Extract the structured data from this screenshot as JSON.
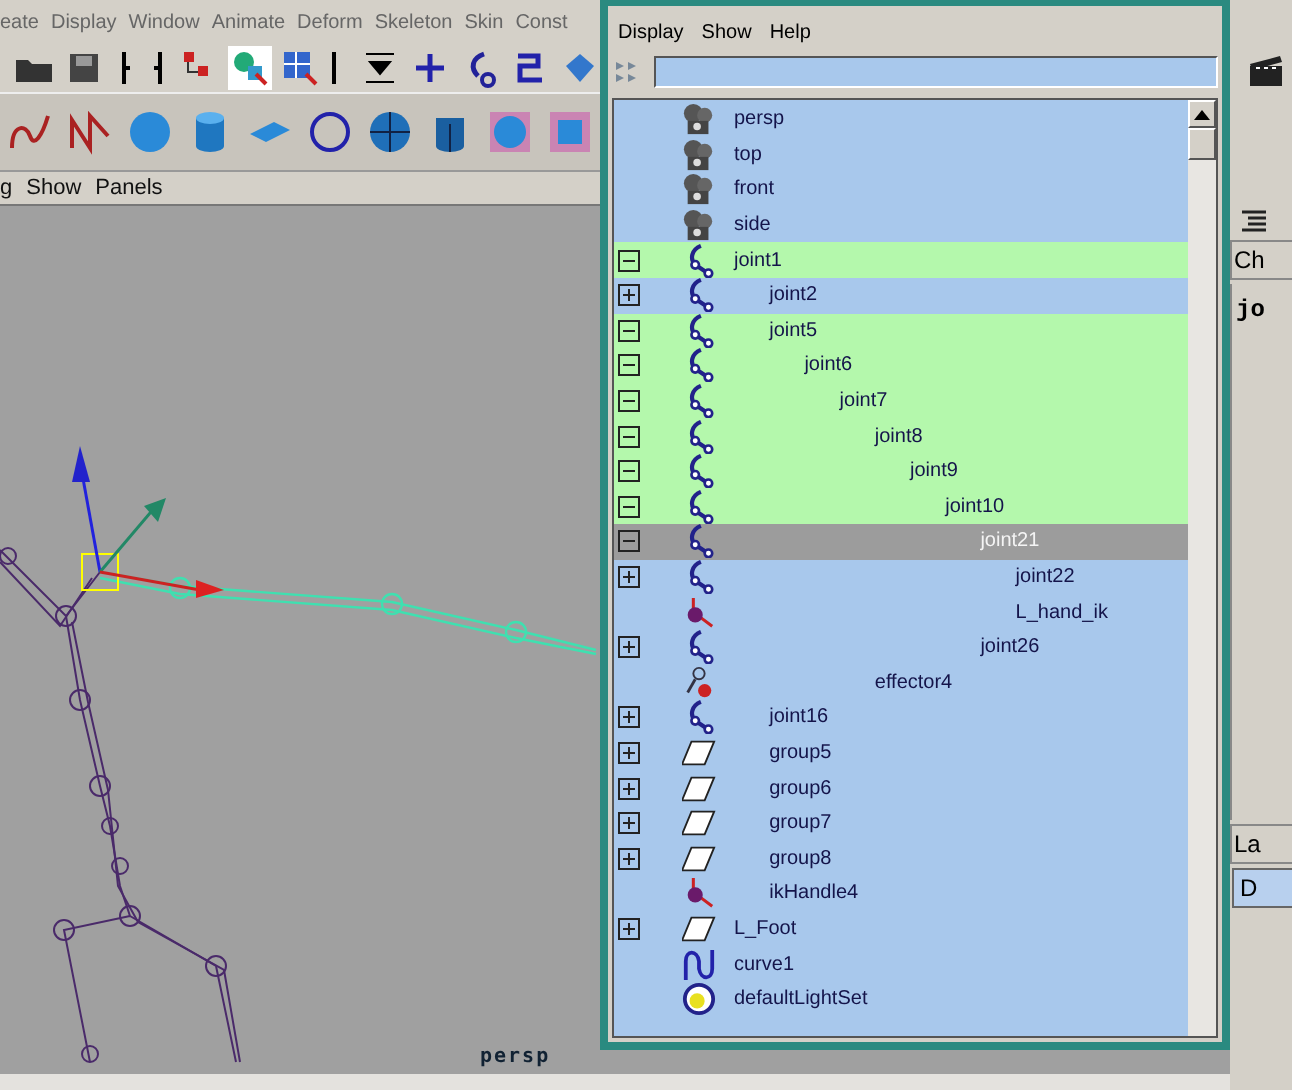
{
  "app_menu": [
    "eate",
    "Display",
    "Window",
    "Animate",
    "Deform",
    "Skeleton",
    "Skin",
    "Const"
  ],
  "panel_menu": [
    "g",
    "Show",
    "Panels"
  ],
  "viewport": {
    "camera_label": "persp"
  },
  "outliner": {
    "menu": [
      "Display",
      "Show",
      "Help"
    ],
    "items": [
      {
        "label": "persp",
        "kind": "camera",
        "expandable": false,
        "selected": false,
        "active": false
      },
      {
        "label": "top",
        "kind": "camera",
        "expandable": false,
        "selected": false,
        "active": false
      },
      {
        "label": "front",
        "kind": "camera",
        "expandable": false,
        "selected": false,
        "active": false
      },
      {
        "label": "side",
        "kind": "camera",
        "expandable": false,
        "selected": false,
        "active": false
      },
      {
        "label": "joint1",
        "kind": "joint",
        "expandable": true,
        "expanded": true,
        "selected": true,
        "active": false,
        "children": [
          {
            "label": "joint2",
            "kind": "joint",
            "expandable": true,
            "expanded": false,
            "selected": false,
            "active": false
          },
          {
            "label": "joint5",
            "kind": "joint",
            "expandable": true,
            "expanded": true,
            "selected": true,
            "active": false,
            "children": [
              {
                "label": "joint6",
                "kind": "joint",
                "expandable": true,
                "expanded": true,
                "selected": true,
                "active": false,
                "children": [
                  {
                    "label": "joint7",
                    "kind": "joint",
                    "expandable": true,
                    "expanded": true,
                    "selected": true,
                    "active": false,
                    "children": [
                      {
                        "label": "joint8",
                        "kind": "joint",
                        "expandable": true,
                        "expanded": true,
                        "selected": true,
                        "active": false,
                        "children": [
                          {
                            "label": "joint9",
                            "kind": "joint",
                            "expandable": true,
                            "expanded": true,
                            "selected": true,
                            "active": false,
                            "children": [
                              {
                                "label": "joint10",
                                "kind": "joint",
                                "expandable": true,
                                "expanded": true,
                                "selected": true,
                                "active": false,
                                "children": [
                                  {
                                    "label": "joint21",
                                    "kind": "joint",
                                    "expandable": true,
                                    "expanded": true,
                                    "selected": false,
                                    "active": true,
                                    "children": [
                                      {
                                        "label": "joint22",
                                        "kind": "joint",
                                        "expandable": true,
                                        "expanded": false,
                                        "selected": false,
                                        "active": false
                                      },
                                      {
                                        "label": "L_hand_ik",
                                        "kind": "ik_handle",
                                        "expandable": false,
                                        "selected": false,
                                        "active": false
                                      }
                                    ]
                                  },
                                  {
                                    "label": "joint26",
                                    "kind": "joint",
                                    "expandable": true,
                                    "expanded": false,
                                    "selected": false,
                                    "active": false
                                  }
                                ]
                              }
                            ]
                          }
                        ]
                      },
                      {
                        "label": "effector4",
                        "kind": "effector",
                        "expandable": false,
                        "selected": false,
                        "active": false
                      }
                    ]
                  }
                ]
              }
            ]
          },
          {
            "label": "joint16",
            "kind": "joint",
            "expandable": true,
            "expanded": false,
            "selected": false,
            "active": false
          },
          {
            "label": "group5",
            "kind": "group",
            "expandable": true,
            "expanded": false,
            "selected": false,
            "active": false
          },
          {
            "label": "group6",
            "kind": "group",
            "expandable": true,
            "expanded": false,
            "selected": false,
            "active": false
          },
          {
            "label": "group7",
            "kind": "group",
            "expandable": true,
            "expanded": false,
            "selected": false,
            "active": false
          },
          {
            "label": "group8",
            "kind": "group",
            "expandable": true,
            "expanded": false,
            "selected": false,
            "active": false
          },
          {
            "label": "ikHandle4",
            "kind": "ik_handle",
            "expandable": false,
            "selected": false,
            "active": false
          }
        ]
      },
      {
        "label": "L_Foot",
        "kind": "group",
        "expandable": true,
        "expanded": false,
        "selected": false,
        "active": false
      },
      {
        "label": "curve1",
        "kind": "curve",
        "expandable": false,
        "selected": false,
        "active": false
      },
      {
        "label": "defaultLightSet",
        "kind": "set",
        "expandable": false,
        "selected": false,
        "active": false
      }
    ]
  },
  "side_panel": {
    "tab": "Ch",
    "node": "jo",
    "layer_tab": "La",
    "layer_button": "D"
  }
}
